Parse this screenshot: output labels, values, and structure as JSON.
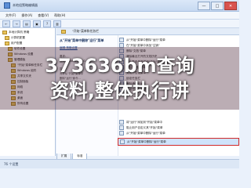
{
  "window": {
    "title": "本地组策略编辑器",
    "controls": [
      "—",
      "□",
      "✕"
    ]
  },
  "menu": [
    "文件(F)",
    "操作(A)",
    "查看(V)",
    "帮助(H)"
  ],
  "toolbar": [
    "←",
    "→",
    "▤",
    "▣",
    "?",
    "▥"
  ],
  "tree": [
    "本地计算机 策略",
    "计算机配置",
    "用户配置",
    "软件设置",
    "Windows 设置",
    "管理模板",
    "\"开始\"菜单和任务栏",
    "Windows 组件",
    "共享文件夹",
    "控制面板",
    "网络",
    "系统",
    "桌面",
    "所有设置"
  ],
  "main": {
    "header": "\"开始\"菜单和任务栏",
    "description": {
      "title": "从\"开始\"菜单中删除\"运行\"菜单",
      "edit_link": "编辑 策略设置",
      "lines": [
        "要求:",
        "至少 Windows 2000",
        "描述:",
        "允许从\"开始\"菜单中",
        "删除\"运行\"命令..."
      ]
    },
    "list": [
      "从\"开始\"菜单中删除\"运行\"菜单",
      "在\"开始\"菜单中添加\"注销\"",
      "删除\"文档\"菜单",
      "清除最近打开的文档历史",
      "阻止更改任务栏和\"开始\"菜单设置",
      "删除\"帮助\"菜单",
      "关闭个性化菜单",
      "锁定任务栏",
      "删除通知区域",
      "关闭任务栏缩略图"
    ],
    "extra_rows": [
      "将\"运行\"添加到\"开始\"菜单中",
      "阻止用户自定义其\"开始\"菜单",
      "从\"开始\"菜单中删除\"运行\"菜单"
    ],
    "selected": "从\"开始\"菜单中删除\"运行\"菜单"
  },
  "tabs": [
    "扩展",
    "标准"
  ],
  "status": "76 个设置",
  "overlay": [
    "373636bm查询",
    "资料,整体执行讲"
  ]
}
